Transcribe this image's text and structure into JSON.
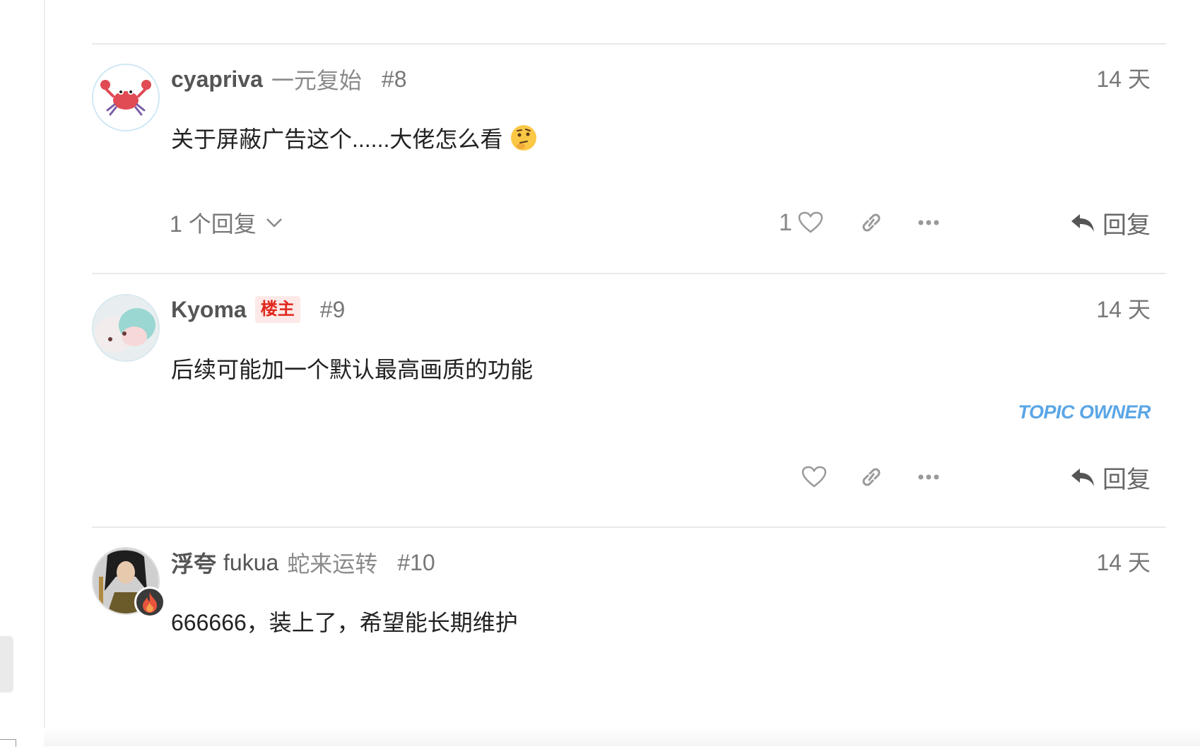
{
  "posts": [
    {
      "username": "cyapriva",
      "title": "一元复始",
      "post_number": "#8",
      "date": "14 天",
      "content": "关于屏蔽广告这个......大佬怎么看",
      "content_emoji": "thinking-face-icon",
      "replies_label": "1 个回复",
      "like_count": "1",
      "reply_label": "回复"
    },
    {
      "username": "Kyoma",
      "op_badge": "楼主",
      "post_number": "#9",
      "date": "14 天",
      "content": "后续可能加一个默认最高画质的功能",
      "owner_tag": "TOPIC OWNER",
      "reply_label": "回复"
    },
    {
      "full_name": "浮夸",
      "username": "fukua",
      "title": "蛇来运转",
      "post_number": "#10",
      "date": "14 天",
      "content": "666666，装上了，希望能长期维护"
    }
  ],
  "colors": {
    "op_badge_bg": "#fde9e7",
    "op_badge_text": "#e0281d",
    "owner_tag": "#5aa6e6"
  },
  "icons": {
    "like": "heart-icon",
    "share": "link-icon",
    "more": "ellipsis-icon",
    "reply": "reply-arrow-icon",
    "expand": "chevron-down-icon",
    "flair": "flame-icon"
  }
}
